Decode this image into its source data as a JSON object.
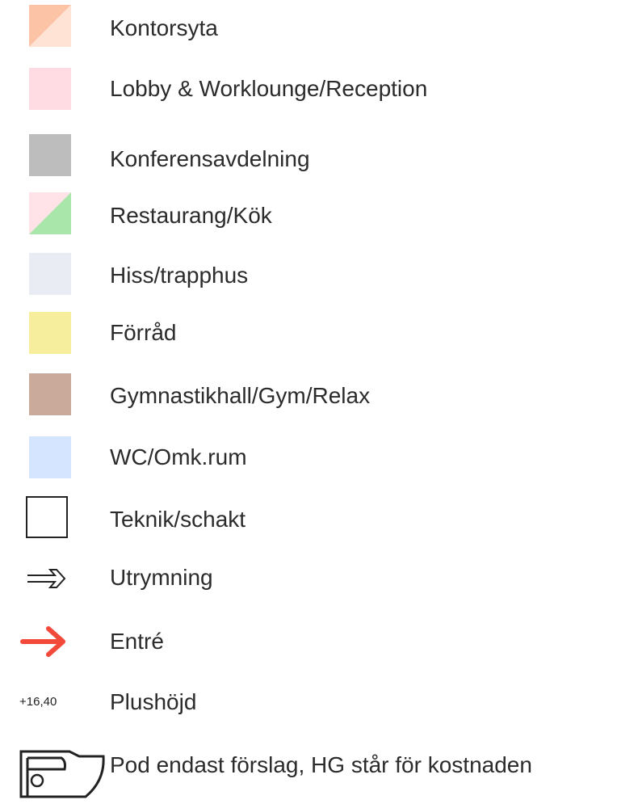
{
  "legend": {
    "items": [
      {
        "id": "kontorsyta",
        "label": "Kontorsyta",
        "symbol": "swatch-diagonal-orange",
        "colors": [
          "#fcc3a6",
          "#ffe0cf"
        ]
      },
      {
        "id": "lobby",
        "label": "Lobby & Worklounge/Reception",
        "symbol": "swatch",
        "colors": [
          "#ffdbe3"
        ]
      },
      {
        "id": "konferens",
        "label": "Konferensavdelning",
        "symbol": "swatch",
        "colors": [
          "#bdbdbd"
        ]
      },
      {
        "id": "restaurang",
        "label": "Restaurang/Kök",
        "symbol": "swatch-diagonal-pink-green",
        "colors": [
          "#ffe3e8",
          "#a9e6a9"
        ]
      },
      {
        "id": "hiss",
        "label": "Hiss/trapphus",
        "symbol": "swatch",
        "colors": [
          "#e9edf3"
        ]
      },
      {
        "id": "forrad",
        "label": "Förråd",
        "symbol": "swatch",
        "colors": [
          "#f6ee9c"
        ]
      },
      {
        "id": "gym",
        "label": "Gymnastikhall/Gym/Relax",
        "symbol": "swatch",
        "colors": [
          "#c9aa9b"
        ]
      },
      {
        "id": "wc",
        "label": "WC/Omk.rum",
        "symbol": "swatch",
        "colors": [
          "#d6e5ff"
        ]
      },
      {
        "id": "teknik",
        "label": "Teknik/schakt",
        "symbol": "outline-square",
        "colors": [
          "#222222"
        ]
      },
      {
        "id": "utrymning",
        "label": "Utrymning",
        "symbol": "outline-arrow",
        "colors": [
          "#222222"
        ]
      },
      {
        "id": "entre",
        "label": "Entré",
        "symbol": "red-arrow",
        "colors": [
          "#f2493a"
        ]
      },
      {
        "id": "plushojd",
        "label": "Plushöjd",
        "symbol": "height-marker",
        "marker_text": "+16,40"
      },
      {
        "id": "pod",
        "label": "Pod  endast förslag, HG står för kostnaden",
        "symbol": "pod-outline"
      }
    ]
  }
}
